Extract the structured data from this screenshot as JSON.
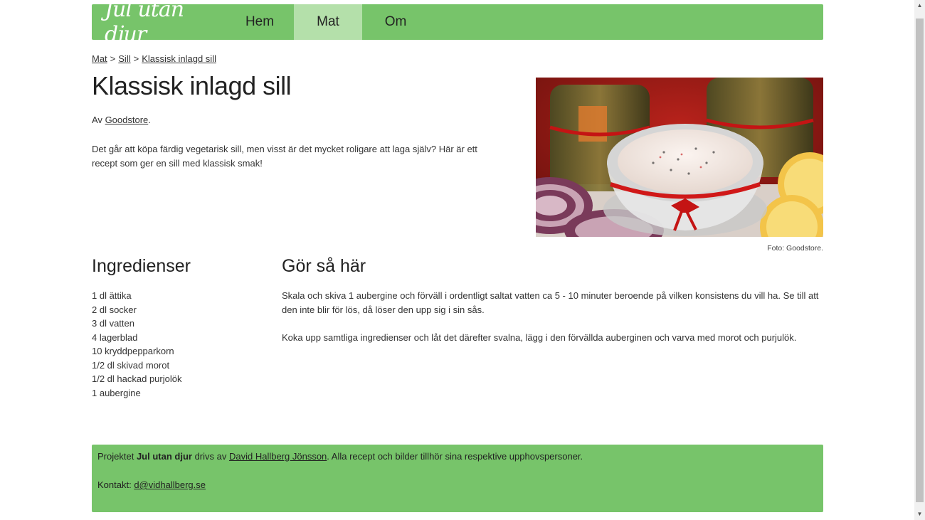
{
  "nav": {
    "logo": "Jul utan djur",
    "items": [
      {
        "label": "Hem",
        "active": false
      },
      {
        "label": "Mat",
        "active": true
      },
      {
        "label": "Om",
        "active": false
      }
    ]
  },
  "breadcrumb": [
    {
      "label": "Mat"
    },
    {
      "label": "Sill"
    },
    {
      "label": "Klassisk inlagd sill"
    }
  ],
  "breadcrumb_separator": ">",
  "recipe": {
    "title": "Klassisk inlagd sill",
    "byline_prefix": "Av",
    "author": "Goodstore",
    "byline_suffix": ".",
    "intro": "Det går att köpa färdig vegetarisk sill, men visst är det mycket roligare att laga själv? Här är ett recept som ger en sill med klassisk smak!",
    "photo_caption": "Foto: Goodstore."
  },
  "ingredients": {
    "heading": "Ingredienser",
    "items": [
      "1 dl ättika",
      "2 dl socker",
      "3 dl vatten",
      "4 lagerblad",
      "10 kryddpepparkorn",
      "1/2 dl skivad morot",
      "1/2 dl hackad purjolök",
      "1 aubergine"
    ]
  },
  "instructions": {
    "heading": "Gör så här",
    "steps": [
      "Skala och skiva 1 aubergine och förväll i ordentligt saltat vatten ca 5 - 10 minuter beroende på vilken konsistens du vill ha. Se till att den inte blir för lös, då löser den upp sig i sin sås.",
      "Koka upp samtliga ingredienser och låt det därefter svalna, lägg i den förvällda auberginen och varva med morot och purjulök."
    ]
  },
  "footer": {
    "prefix": "Projektet",
    "project": "Jul utan djur",
    "middle": "drivs av",
    "owner": "David Hallberg Jönsson",
    "suffix": ". Alla recept och bilder tillhör sina respektive upphovspersoner.",
    "contact_label": "Kontakt:",
    "contact_email": "d@vidhallberg.se"
  },
  "colors": {
    "nav_bg": "#77c46a",
    "nav_active": "#b4e0aa",
    "footer_bg": "#77c46a"
  }
}
